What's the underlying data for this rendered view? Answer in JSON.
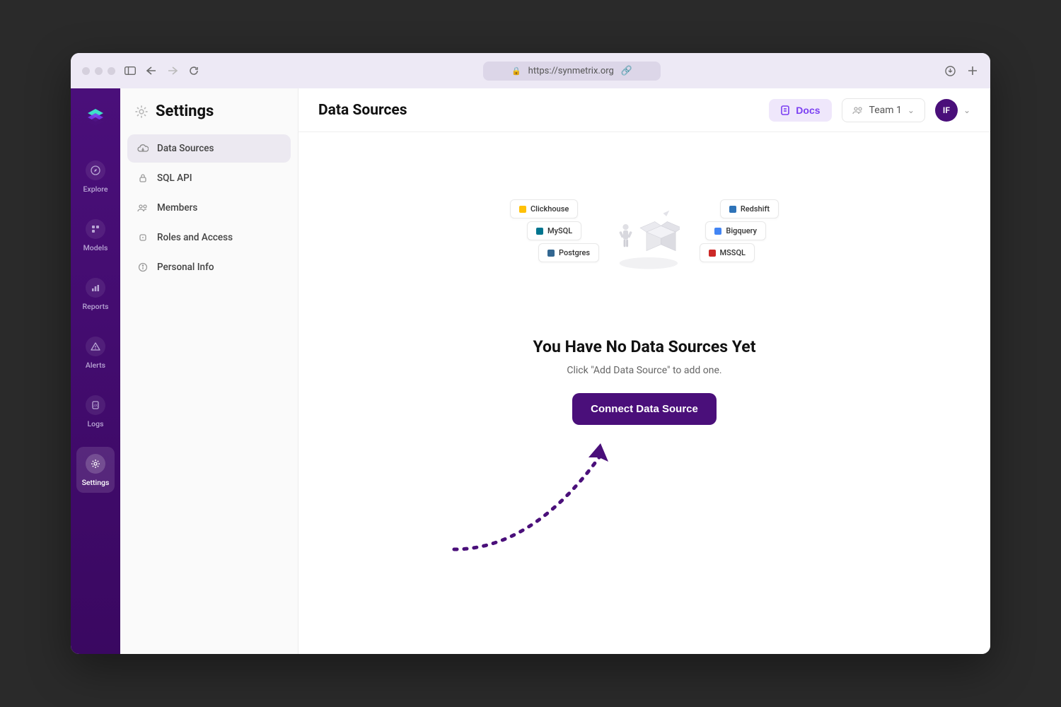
{
  "browser": {
    "url": "https://synmetrix.org"
  },
  "sidebar": {
    "items": [
      {
        "label": "Explore",
        "icon": "compass-icon"
      },
      {
        "label": "Models",
        "icon": "models-icon"
      },
      {
        "label": "Reports",
        "icon": "chart-icon"
      },
      {
        "label": "Alerts",
        "icon": "alert-icon"
      },
      {
        "label": "Logs",
        "icon": "log-icon"
      },
      {
        "label": "Settings",
        "icon": "gear-icon"
      }
    ],
    "active_index": 5
  },
  "settings_panel": {
    "title": "Settings",
    "items": [
      {
        "label": "Data Sources",
        "icon": "cloud-icon"
      },
      {
        "label": "SQL API",
        "icon": "lock-icon"
      },
      {
        "label": "Members",
        "icon": "people-icon"
      },
      {
        "label": "Roles and Access",
        "icon": "key-icon"
      },
      {
        "label": "Personal Info",
        "icon": "info-icon"
      }
    ],
    "active_index": 0
  },
  "topbar": {
    "page_title": "Data Sources",
    "docs_label": "Docs",
    "team_label": "Team 1",
    "avatar_initials": "IF"
  },
  "empty_state": {
    "heading": "You Have No Data Sources Yet",
    "sub": "Click \"Add Data Source\" to add one.",
    "cta_label": "Connect Data Source",
    "chips_left": [
      "Clickhouse",
      "MySQL",
      "Postgres"
    ],
    "chips_right": [
      "Redshift",
      "Bigquery",
      "MSSQL"
    ]
  }
}
